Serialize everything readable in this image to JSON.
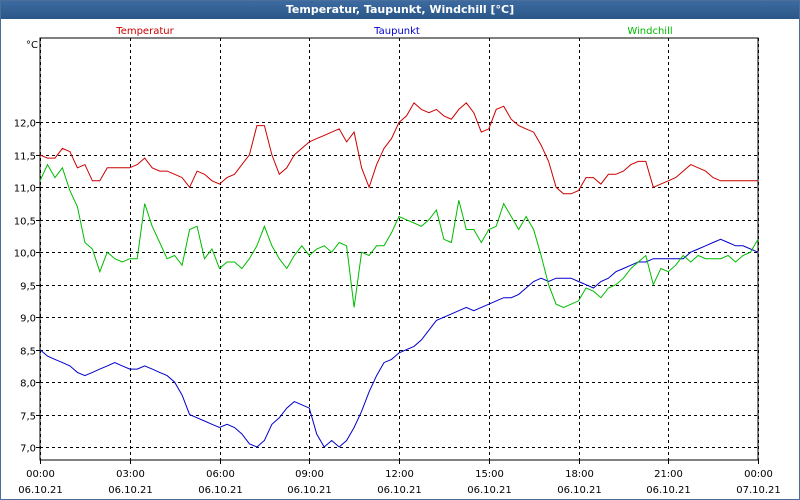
{
  "window": {
    "title": "Temperatur, Taupunkt, Windchill [°C]"
  },
  "colors": {
    "temperatur": "#cc0000",
    "taupunkt": "#0000cc",
    "windchill": "#00bb00",
    "grid": "#000000"
  },
  "chart_data": {
    "type": "line",
    "title": "Temperatur, Taupunkt, Windchill [°C]",
    "ylabel": "°C",
    "ylim": [
      6.8,
      13.3
    ],
    "yticks": [
      7.0,
      7.5,
      8.0,
      8.5,
      9.0,
      9.5,
      10.0,
      10.5,
      11.0,
      11.5,
      12.0
    ],
    "ytick_labels": [
      "7,0",
      "7,5",
      "8,0",
      "8,5",
      "9,0",
      "9,5",
      "10,0",
      "10,5",
      "11,0",
      "11,5",
      "12,0"
    ],
    "xlim": [
      0,
      24
    ],
    "xticks": [
      0,
      3,
      6,
      9,
      12,
      15,
      18,
      21,
      24
    ],
    "xtick_labels": [
      [
        "00:00",
        "06.10.21"
      ],
      [
        "03:00",
        "06.10.21"
      ],
      [
        "06:00",
        "06.10.21"
      ],
      [
        "09:00",
        "06.10.21"
      ],
      [
        "12:00",
        "06.10.21"
      ],
      [
        "15:00",
        "06.10.21"
      ],
      [
        "18:00",
        "06.10.21"
      ],
      [
        "21:00",
        "06.10.21"
      ],
      [
        "00:00",
        "07.10.21"
      ]
    ],
    "grid": true,
    "legend_placement": "top",
    "series": [
      {
        "name": "Temperatur",
        "color": "#cc0000",
        "x": [
          0,
          0.25,
          0.5,
          0.75,
          1.0,
          1.25,
          1.5,
          1.75,
          2.0,
          2.25,
          2.5,
          2.75,
          3.0,
          3.25,
          3.5,
          3.75,
          4.0,
          4.25,
          4.5,
          4.75,
          5.0,
          5.25,
          5.5,
          5.75,
          6.0,
          6.25,
          6.5,
          6.75,
          7.0,
          7.25,
          7.5,
          7.75,
          8.0,
          8.25,
          8.5,
          8.75,
          9.0,
          9.25,
          9.5,
          9.75,
          10.0,
          10.25,
          10.5,
          10.75,
          11.0,
          11.25,
          11.5,
          11.75,
          12.0,
          12.25,
          12.5,
          12.75,
          13.0,
          13.25,
          13.5,
          13.75,
          14.0,
          14.25,
          14.5,
          14.75,
          15.0,
          15.25,
          15.5,
          15.75,
          16.0,
          16.25,
          16.5,
          16.75,
          17.0,
          17.25,
          17.5,
          17.75,
          18.0,
          18.25,
          18.5,
          18.75,
          19.0,
          19.25,
          19.5,
          19.75,
          20.0,
          20.25,
          20.5,
          20.75,
          21.0,
          21.25,
          21.5,
          21.75,
          22.0,
          22.25,
          22.5,
          22.75,
          23.0,
          23.25,
          23.5,
          23.75,
          24.0
        ],
        "y": [
          11.5,
          11.45,
          11.45,
          11.6,
          11.55,
          11.3,
          11.35,
          11.1,
          11.1,
          11.3,
          11.3,
          11.3,
          11.3,
          11.35,
          11.45,
          11.3,
          11.25,
          11.25,
          11.2,
          11.15,
          11.0,
          11.25,
          11.2,
          11.1,
          11.05,
          11.15,
          11.2,
          11.35,
          11.5,
          11.95,
          11.95,
          11.5,
          11.2,
          11.3,
          11.5,
          11.6,
          11.7,
          11.75,
          11.8,
          11.85,
          11.9,
          11.7,
          11.85,
          11.3,
          11.0,
          11.35,
          11.6,
          11.75,
          12.0,
          12.1,
          12.3,
          12.2,
          12.15,
          12.2,
          12.1,
          12.05,
          12.2,
          12.3,
          12.15,
          11.85,
          11.9,
          12.2,
          12.25,
          12.05,
          11.95,
          11.9,
          11.85,
          11.65,
          11.4,
          11.0,
          10.9,
          10.9,
          10.95,
          11.15,
          11.15,
          11.05,
          11.2,
          11.2,
          11.25,
          11.35,
          11.4,
          11.4,
          11.0,
          11.05,
          11.1,
          11.15,
          11.25,
          11.35,
          11.3,
          11.25,
          11.15,
          11.1,
          11.1,
          11.1,
          11.1,
          11.1,
          11.1
        ]
      },
      {
        "name": "Taupunkt",
        "color": "#0000cc",
        "x": [
          0,
          0.25,
          0.5,
          0.75,
          1.0,
          1.25,
          1.5,
          1.75,
          2.0,
          2.25,
          2.5,
          2.75,
          3.0,
          3.25,
          3.5,
          3.75,
          4.0,
          4.25,
          4.5,
          4.75,
          5.0,
          5.25,
          5.5,
          5.75,
          6.0,
          6.25,
          6.5,
          6.75,
          7.0,
          7.25,
          7.5,
          7.75,
          8.0,
          8.25,
          8.5,
          8.75,
          9.0,
          9.25,
          9.5,
          9.75,
          10.0,
          10.25,
          10.5,
          10.75,
          11.0,
          11.25,
          11.5,
          11.75,
          12.0,
          12.25,
          12.5,
          12.75,
          13.0,
          13.25,
          13.5,
          13.75,
          14.0,
          14.25,
          14.5,
          14.75,
          15.0,
          15.25,
          15.5,
          15.75,
          16.0,
          16.25,
          16.5,
          16.75,
          17.0,
          17.25,
          17.5,
          17.75,
          18.0,
          18.25,
          18.5,
          18.75,
          19.0,
          19.25,
          19.5,
          19.75,
          20.0,
          20.25,
          20.5,
          20.75,
          21.0,
          21.25,
          21.5,
          21.75,
          22.0,
          22.25,
          22.5,
          22.75,
          23.0,
          23.25,
          23.5,
          23.75,
          24.0
        ],
        "y": [
          8.5,
          8.4,
          8.35,
          8.3,
          8.25,
          8.15,
          8.1,
          8.15,
          8.2,
          8.25,
          8.3,
          8.25,
          8.2,
          8.2,
          8.25,
          8.2,
          8.15,
          8.1,
          8.0,
          7.8,
          7.5,
          7.45,
          7.4,
          7.35,
          7.3,
          7.35,
          7.3,
          7.2,
          7.05,
          7.0,
          7.1,
          7.35,
          7.45,
          7.6,
          7.7,
          7.65,
          7.6,
          7.2,
          7.0,
          7.1,
          7.0,
          7.1,
          7.3,
          7.55,
          7.85,
          8.1,
          8.3,
          8.35,
          8.45,
          8.5,
          8.55,
          8.65,
          8.8,
          8.95,
          9.0,
          9.05,
          9.1,
          9.15,
          9.1,
          9.15,
          9.2,
          9.25,
          9.3,
          9.3,
          9.35,
          9.45,
          9.55,
          9.6,
          9.55,
          9.6,
          9.6,
          9.6,
          9.55,
          9.5,
          9.45,
          9.55,
          9.6,
          9.7,
          9.75,
          9.8,
          9.85,
          9.85,
          9.9,
          9.9,
          9.9,
          9.9,
          9.9,
          10.0,
          10.05,
          10.1,
          10.15,
          10.2,
          10.15,
          10.1,
          10.1,
          10.05,
          10.0
        ]
      },
      {
        "name": "Windchill",
        "color": "#00bb00",
        "x": [
          0,
          0.25,
          0.5,
          0.75,
          1.0,
          1.25,
          1.5,
          1.75,
          2.0,
          2.25,
          2.5,
          2.75,
          3.0,
          3.25,
          3.5,
          3.75,
          4.0,
          4.25,
          4.5,
          4.75,
          5.0,
          5.25,
          5.5,
          5.75,
          6.0,
          6.25,
          6.5,
          6.75,
          7.0,
          7.25,
          7.5,
          7.75,
          8.0,
          8.25,
          8.5,
          8.75,
          9.0,
          9.25,
          9.5,
          9.75,
          10.0,
          10.25,
          10.5,
          10.75,
          11.0,
          11.25,
          11.5,
          11.75,
          12.0,
          12.25,
          12.5,
          12.75,
          13.0,
          13.25,
          13.5,
          13.75,
          14.0,
          14.25,
          14.5,
          14.75,
          15.0,
          15.25,
          15.5,
          15.75,
          16.0,
          16.25,
          16.5,
          16.75,
          17.0,
          17.25,
          17.5,
          17.75,
          18.0,
          18.25,
          18.5,
          18.75,
          19.0,
          19.25,
          19.5,
          19.75,
          20.0,
          20.25,
          20.5,
          20.75,
          21.0,
          21.25,
          21.5,
          21.75,
          22.0,
          22.25,
          22.5,
          22.75,
          23.0,
          23.25,
          23.5,
          23.75,
          24.0
        ],
        "y": [
          11.1,
          11.35,
          11.15,
          11.3,
          10.95,
          10.7,
          10.15,
          10.05,
          9.7,
          10.0,
          9.9,
          9.85,
          9.9,
          9.9,
          10.75,
          10.4,
          10.15,
          9.9,
          9.95,
          9.8,
          10.35,
          10.4,
          9.9,
          10.05,
          9.75,
          9.85,
          9.85,
          9.75,
          9.9,
          10.1,
          10.4,
          10.1,
          9.9,
          9.75,
          9.95,
          10.1,
          9.95,
          10.05,
          10.1,
          10.0,
          10.15,
          10.1,
          9.15,
          10.0,
          9.95,
          10.1,
          10.1,
          10.3,
          10.55,
          10.5,
          10.45,
          10.4,
          10.5,
          10.65,
          10.2,
          10.15,
          10.8,
          10.35,
          10.35,
          10.15,
          10.35,
          10.4,
          10.75,
          10.55,
          10.35,
          10.55,
          10.35,
          9.95,
          9.5,
          9.2,
          9.15,
          9.2,
          9.25,
          9.45,
          9.4,
          9.3,
          9.45,
          9.5,
          9.6,
          9.75,
          9.85,
          9.95,
          9.5,
          9.75,
          9.7,
          9.8,
          9.95,
          9.85,
          9.95,
          9.9,
          9.9,
          9.9,
          9.95,
          9.85,
          9.95,
          10.0,
          10.2
        ]
      }
    ]
  }
}
